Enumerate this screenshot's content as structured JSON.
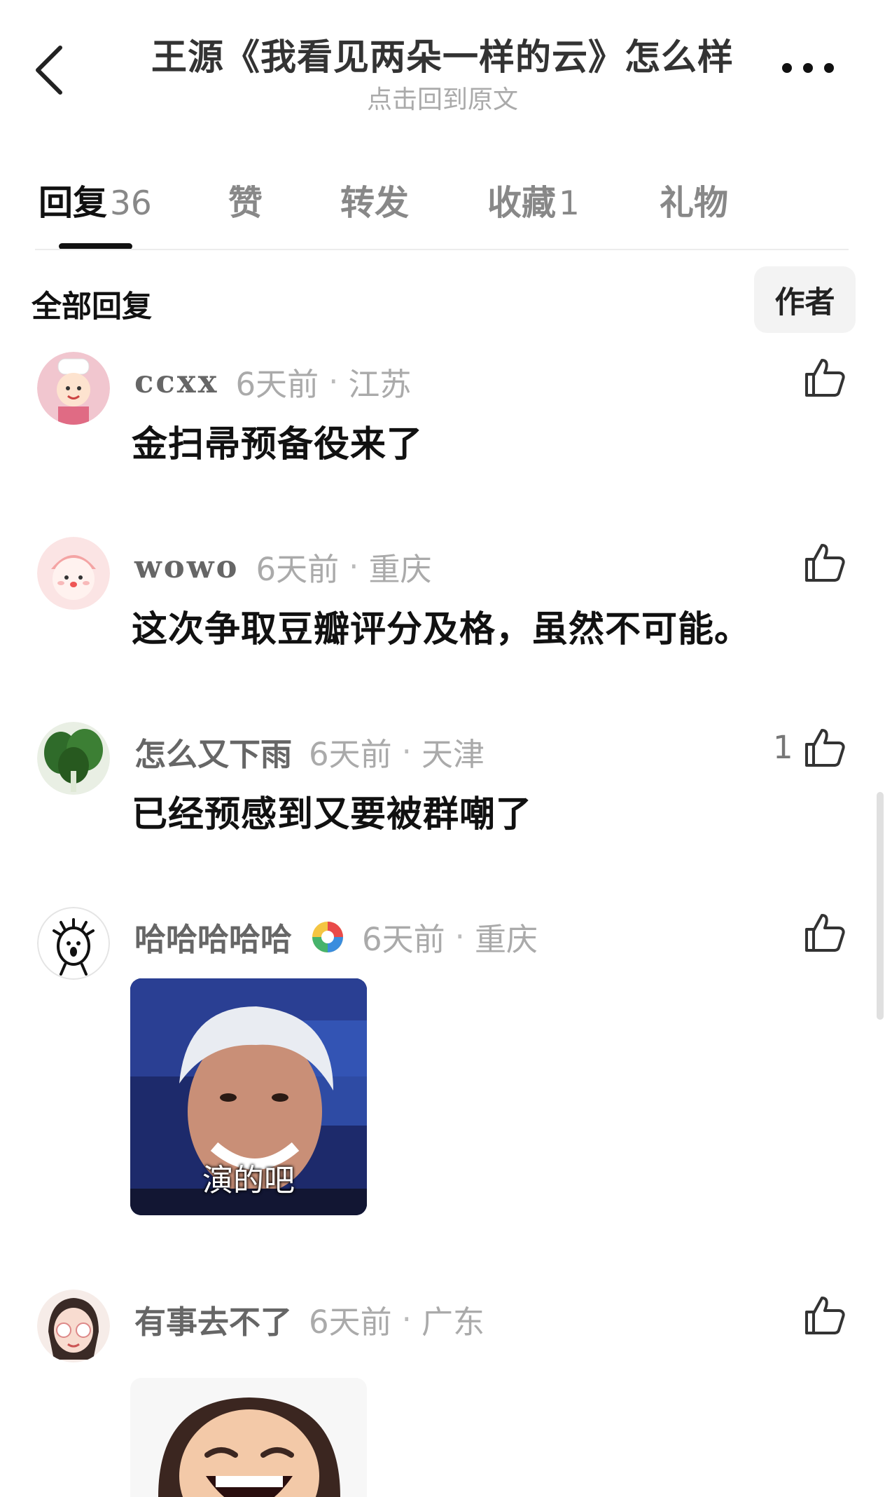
{
  "header": {
    "title": "王源《我看见两朵一样的云》怎么样",
    "subtitle": "点击回到原文",
    "back_icon": "chevron-left-icon",
    "more_icon": "ellipsis-icon"
  },
  "tabs": [
    {
      "label": "回复",
      "count": "36",
      "active": true
    },
    {
      "label": "赞",
      "count": ""
    },
    {
      "label": "转发",
      "count": ""
    },
    {
      "label": "收藏",
      "count": "1"
    },
    {
      "label": "礼物",
      "count": ""
    }
  ],
  "section": {
    "title": "全部回复",
    "filter_button": "作者"
  },
  "comments": [
    {
      "user": "ccxx",
      "time": "6天前",
      "location": "江苏",
      "text": "金扫帚预备役来了",
      "likes": ""
    },
    {
      "user": "wowo",
      "time": "6天前",
      "location": "重庆",
      "text": "这次争取豆瓣评分及格，虽然不可能。",
      "likes": ""
    },
    {
      "user": "怎么又下雨",
      "time": "6天前",
      "location": "天津",
      "text": "已经预感到又要被群嘲了",
      "likes": "1"
    },
    {
      "user": "哈哈哈哈哈",
      "time": "6天前",
      "location": "重庆",
      "sticker_caption": "演的吧",
      "likes": ""
    },
    {
      "user": "有事去不了",
      "time": "6天前",
      "location": "广东",
      "likes": ""
    }
  ],
  "separator": "·",
  "colors": {
    "active_tab": "#111111",
    "muted": "#aaaaaa",
    "username": "#666666"
  }
}
